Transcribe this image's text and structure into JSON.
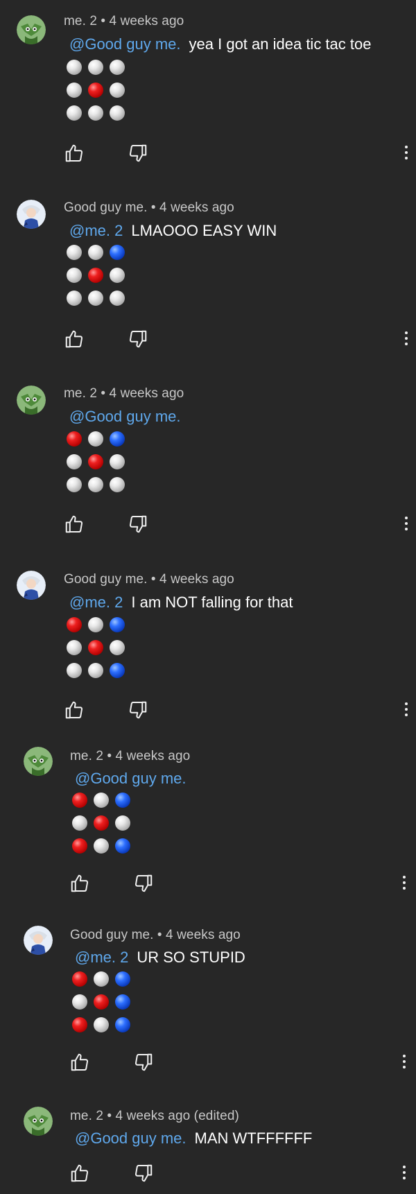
{
  "comments": [
    {
      "author": "me. 2",
      "time": "4 weeks ago",
      "header": "me. 2 • 4 weeks ago",
      "mention": "@Good guy me.",
      "text": "yea I got an idea tic tac toe",
      "avatar": "green-goblin-avatar",
      "board": [
        [
          "w",
          "w",
          "w"
        ],
        [
          "w",
          "r",
          "w"
        ],
        [
          "w",
          "w",
          "w"
        ]
      ]
    },
    {
      "author": "Good guy me.",
      "time": "4 weeks ago",
      "header": "Good guy me. • 4 weeks ago",
      "mention": "@me. 2",
      "text": "LMAOOO EASY WIN",
      "avatar": "blue-character-avatar",
      "board": [
        [
          "w",
          "w",
          "b"
        ],
        [
          "w",
          "r",
          "w"
        ],
        [
          "w",
          "w",
          "w"
        ]
      ]
    },
    {
      "author": "me. 2",
      "time": "4 weeks ago",
      "header": "me. 2 • 4 weeks ago",
      "mention": "@Good guy me.",
      "text": "",
      "avatar": "green-goblin-avatar",
      "board": [
        [
          "r",
          "w",
          "b"
        ],
        [
          "w",
          "r",
          "w"
        ],
        [
          "w",
          "w",
          "w"
        ]
      ]
    },
    {
      "author": "Good guy me.",
      "time": "4 weeks ago",
      "header": "Good guy me. • 4 weeks ago",
      "mention": "@me. 2",
      "text": "I am NOT falling for that",
      "avatar": "blue-character-avatar",
      "board": [
        [
          "r",
          "w",
          "b"
        ],
        [
          "w",
          "r",
          "w"
        ],
        [
          "w",
          "w",
          "b"
        ]
      ]
    },
    {
      "author": "me. 2",
      "time": "4 weeks ago",
      "header": "me. 2 • 4 weeks ago",
      "mention": "@Good guy me.",
      "text": "",
      "avatar": "green-goblin-avatar",
      "board": [
        [
          "r",
          "w",
          "b"
        ],
        [
          "w",
          "r",
          "w"
        ],
        [
          "r",
          "w",
          "b"
        ]
      ]
    },
    {
      "author": "Good guy me.",
      "time": "4 weeks ago",
      "header": "Good guy me. • 4 weeks ago",
      "mention": "@me. 2",
      "text": "UR SO STUPID",
      "avatar": "blue-character-avatar",
      "board": [
        [
          "r",
          "w",
          "b"
        ],
        [
          "w",
          "r",
          "b"
        ],
        [
          "r",
          "w",
          "b"
        ]
      ]
    },
    {
      "author": "me. 2",
      "time": "4 weeks ago (edited)",
      "header": "me. 2 • 4 weeks ago (edited)",
      "mention": "@Good guy me.",
      "text": "MAN WTFFFFFF",
      "avatar": "green-goblin-avatar",
      "board": []
    }
  ],
  "icons": {
    "like": "thumbs-up-icon",
    "dislike": "thumbs-down-icon",
    "more": "more-vertical-icon"
  },
  "colors": {
    "background": "#272727",
    "mention": "#5fa8ec",
    "header_text": "#c8c8c8",
    "text": "#ffffff",
    "marker_white": "#e9e9e9",
    "marker_red": "#ee2020",
    "marker_blue": "#2d6fff"
  }
}
